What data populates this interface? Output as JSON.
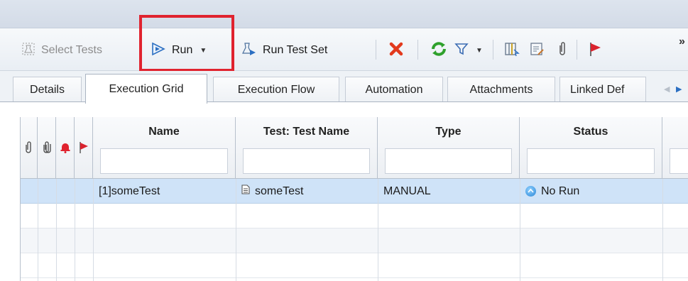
{
  "toolbar": {
    "select_tests_label": "Select Tests",
    "run_label": "Run",
    "run_test_set_label": "Run Test Set",
    "more_label": "»"
  },
  "tabs": [
    {
      "label": "Details"
    },
    {
      "label": "Execution Grid"
    },
    {
      "label": "Execution Flow"
    },
    {
      "label": "Automation"
    },
    {
      "label": "Attachments"
    },
    {
      "label": "Linked Def"
    }
  ],
  "grid": {
    "columns": [
      {
        "label": "Name"
      },
      {
        "label": "Test: Test Name"
      },
      {
        "label": "Type"
      },
      {
        "label": "Status"
      }
    ],
    "rows": [
      {
        "name": "[1]someTest",
        "test_name": "someTest",
        "type": "MANUAL",
        "status": "No Run"
      }
    ]
  },
  "colors": {
    "highlight": "#e0232f",
    "selected_row": "#cfe3f8",
    "delete_icon": "#e23a1d",
    "refresh_icon": "#2fa12c",
    "flag_icon": "#d9232e"
  }
}
